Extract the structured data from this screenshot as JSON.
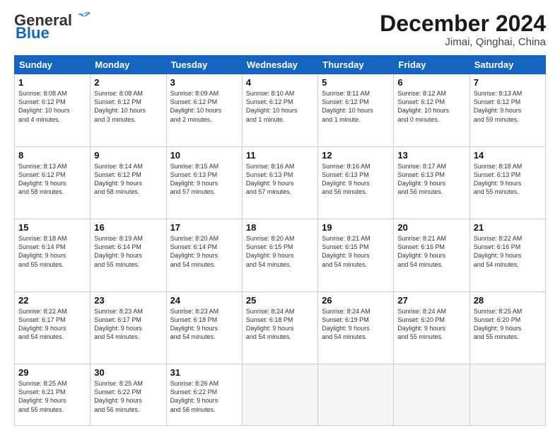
{
  "logo": {
    "general": "General",
    "blue": "Blue"
  },
  "title": "December 2024",
  "location": "Jimai, Qinghai, China",
  "weekdays": [
    "Sunday",
    "Monday",
    "Tuesday",
    "Wednesday",
    "Thursday",
    "Friday",
    "Saturday"
  ],
  "weeks": [
    [
      {
        "day": "1",
        "info": "Sunrise: 8:08 AM\nSunset: 6:12 PM\nDaylight: 10 hours\nand 4 minutes."
      },
      {
        "day": "2",
        "info": "Sunrise: 8:08 AM\nSunset: 6:12 PM\nDaylight: 10 hours\nand 3 minutes."
      },
      {
        "day": "3",
        "info": "Sunrise: 8:09 AM\nSunset: 6:12 PM\nDaylight: 10 hours\nand 2 minutes."
      },
      {
        "day": "4",
        "info": "Sunrise: 8:10 AM\nSunset: 6:12 PM\nDaylight: 10 hours\nand 1 minute."
      },
      {
        "day": "5",
        "info": "Sunrise: 8:11 AM\nSunset: 6:12 PM\nDaylight: 10 hours\nand 1 minute."
      },
      {
        "day": "6",
        "info": "Sunrise: 8:12 AM\nSunset: 6:12 PM\nDaylight: 10 hours\nand 0 minutes."
      },
      {
        "day": "7",
        "info": "Sunrise: 8:13 AM\nSunset: 6:12 PM\nDaylight: 9 hours\nand 59 minutes."
      }
    ],
    [
      {
        "day": "8",
        "info": "Sunrise: 8:13 AM\nSunset: 6:12 PM\nDaylight: 9 hours\nand 58 minutes."
      },
      {
        "day": "9",
        "info": "Sunrise: 8:14 AM\nSunset: 6:12 PM\nDaylight: 9 hours\nand 58 minutes."
      },
      {
        "day": "10",
        "info": "Sunrise: 8:15 AM\nSunset: 6:13 PM\nDaylight: 9 hours\nand 57 minutes."
      },
      {
        "day": "11",
        "info": "Sunrise: 8:16 AM\nSunset: 6:13 PM\nDaylight: 9 hours\nand 57 minutes."
      },
      {
        "day": "12",
        "info": "Sunrise: 8:16 AM\nSunset: 6:13 PM\nDaylight: 9 hours\nand 56 minutes."
      },
      {
        "day": "13",
        "info": "Sunrise: 8:17 AM\nSunset: 6:13 PM\nDaylight: 9 hours\nand 56 minutes."
      },
      {
        "day": "14",
        "info": "Sunrise: 8:18 AM\nSunset: 6:13 PM\nDaylight: 9 hours\nand 55 minutes."
      }
    ],
    [
      {
        "day": "15",
        "info": "Sunrise: 8:18 AM\nSunset: 6:14 PM\nDaylight: 9 hours\nand 55 minutes."
      },
      {
        "day": "16",
        "info": "Sunrise: 8:19 AM\nSunset: 6:14 PM\nDaylight: 9 hours\nand 55 minutes."
      },
      {
        "day": "17",
        "info": "Sunrise: 8:20 AM\nSunset: 6:14 PM\nDaylight: 9 hours\nand 54 minutes."
      },
      {
        "day": "18",
        "info": "Sunrise: 8:20 AM\nSunset: 6:15 PM\nDaylight: 9 hours\nand 54 minutes."
      },
      {
        "day": "19",
        "info": "Sunrise: 8:21 AM\nSunset: 6:15 PM\nDaylight: 9 hours\nand 54 minutes."
      },
      {
        "day": "20",
        "info": "Sunrise: 8:21 AM\nSunset: 6:16 PM\nDaylight: 9 hours\nand 54 minutes."
      },
      {
        "day": "21",
        "info": "Sunrise: 8:22 AM\nSunset: 6:16 PM\nDaylight: 9 hours\nand 54 minutes."
      }
    ],
    [
      {
        "day": "22",
        "info": "Sunrise: 8:22 AM\nSunset: 6:17 PM\nDaylight: 9 hours\nand 54 minutes."
      },
      {
        "day": "23",
        "info": "Sunrise: 8:23 AM\nSunset: 6:17 PM\nDaylight: 9 hours\nand 54 minutes."
      },
      {
        "day": "24",
        "info": "Sunrise: 8:23 AM\nSunset: 6:18 PM\nDaylight: 9 hours\nand 54 minutes."
      },
      {
        "day": "25",
        "info": "Sunrise: 8:24 AM\nSunset: 6:18 PM\nDaylight: 9 hours\nand 54 minutes."
      },
      {
        "day": "26",
        "info": "Sunrise: 8:24 AM\nSunset: 6:19 PM\nDaylight: 9 hours\nand 54 minutes."
      },
      {
        "day": "27",
        "info": "Sunrise: 8:24 AM\nSunset: 6:20 PM\nDaylight: 9 hours\nand 55 minutes."
      },
      {
        "day": "28",
        "info": "Sunrise: 8:25 AM\nSunset: 6:20 PM\nDaylight: 9 hours\nand 55 minutes."
      }
    ],
    [
      {
        "day": "29",
        "info": "Sunrise: 8:25 AM\nSunset: 6:21 PM\nDaylight: 9 hours\nand 55 minutes."
      },
      {
        "day": "30",
        "info": "Sunrise: 8:25 AM\nSunset: 6:22 PM\nDaylight: 9 hours\nand 56 minutes."
      },
      {
        "day": "31",
        "info": "Sunrise: 8:26 AM\nSunset: 6:22 PM\nDaylight: 9 hours\nand 56 minutes."
      },
      {
        "day": "",
        "info": ""
      },
      {
        "day": "",
        "info": ""
      },
      {
        "day": "",
        "info": ""
      },
      {
        "day": "",
        "info": ""
      }
    ]
  ]
}
